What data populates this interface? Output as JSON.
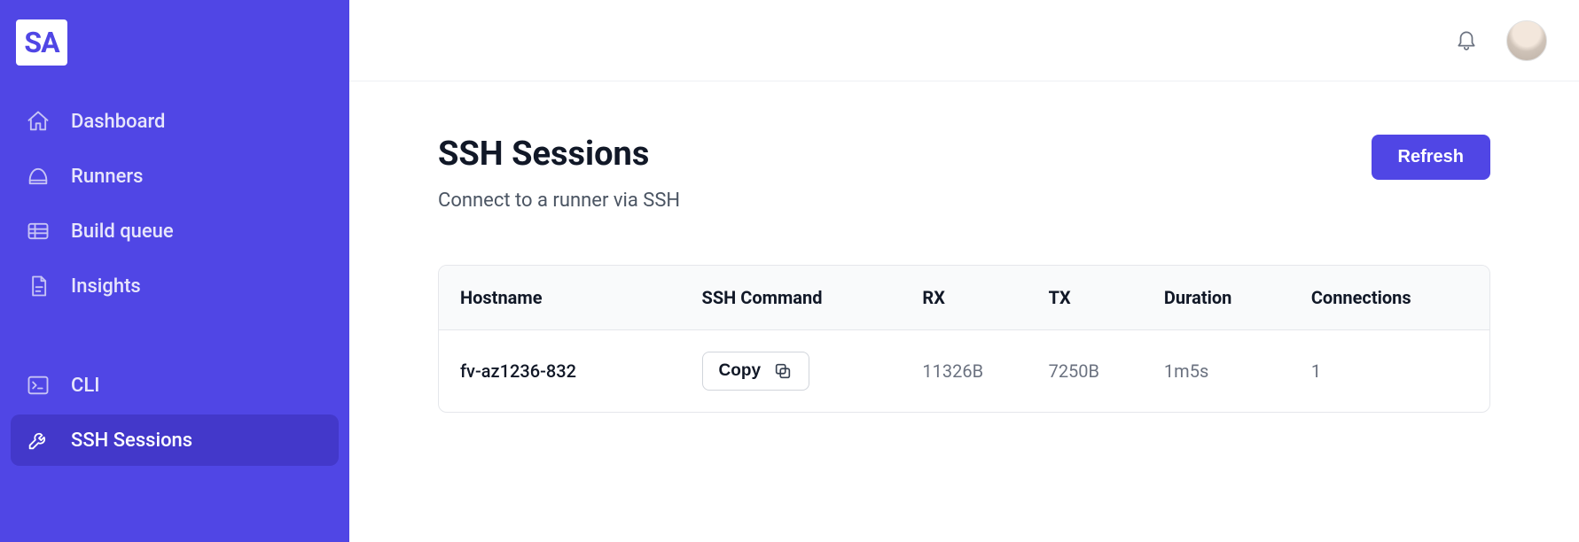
{
  "logo": "SA",
  "sidebar": {
    "items": [
      {
        "label": "Dashboard"
      },
      {
        "label": "Runners"
      },
      {
        "label": "Build queue"
      },
      {
        "label": "Insights"
      },
      {
        "label": "CLI"
      },
      {
        "label": "SSH Sessions"
      }
    ]
  },
  "header": {
    "title": "SSH Sessions",
    "subtitle": "Connect to a runner via SSH",
    "refresh_label": "Refresh"
  },
  "table": {
    "columns": [
      "Hostname",
      "SSH Command",
      "RX",
      "TX",
      "Duration",
      "Connections"
    ],
    "copy_label": "Copy",
    "rows": [
      {
        "hostname": "fv-az1236-832",
        "rx": "11326B",
        "tx": "7250B",
        "duration": "1m5s",
        "connections": "1"
      }
    ]
  }
}
